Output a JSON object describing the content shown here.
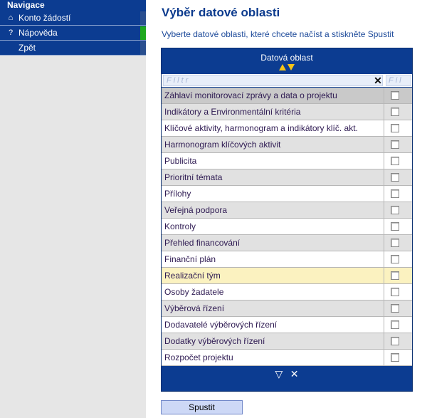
{
  "navigation": {
    "heading": "Navigace",
    "items": [
      {
        "label": "Konto žádostí",
        "icon": "⌂",
        "active": false
      },
      {
        "label": "Nápověda",
        "icon": "?",
        "active": true
      },
      {
        "label": "Zpět",
        "icon": "",
        "active": false
      }
    ]
  },
  "main": {
    "title": "Výběr datové oblasti",
    "subtitle": "Vyberte datové oblasti, které chcete načíst a stiskněte Spustit"
  },
  "grid": {
    "column_header": "Datová oblast",
    "filter_placeholder": "Filtr",
    "filter_placeholder_2": "Fil",
    "clear_glyph": "✕",
    "rows": [
      {
        "label": "Záhlaví monitorovací zprávy a data o projektu",
        "checked": false
      },
      {
        "label": "Indikátory a Environmentální kritéria",
        "checked": false
      },
      {
        "label": "Klíčové aktivity, harmonogram a indikátory klíč. akt.",
        "checked": false
      },
      {
        "label": "Harmonogram klíčových aktivit",
        "checked": false
      },
      {
        "label": "Publicita",
        "checked": false
      },
      {
        "label": "Prioritní témata",
        "checked": false
      },
      {
        "label": "Přílohy",
        "checked": false
      },
      {
        "label": "Veřejná podpora",
        "checked": false
      },
      {
        "label": "Kontroly",
        "checked": false
      },
      {
        "label": "Přehled financování",
        "checked": false
      },
      {
        "label": "Finanční plán",
        "checked": false
      },
      {
        "label": "Realizační tým",
        "checked": false
      },
      {
        "label": "Osoby žadatele",
        "checked": false
      },
      {
        "label": "Výběrová řízení",
        "checked": false
      },
      {
        "label": "Dodavatelé výběrových řízení",
        "checked": false
      },
      {
        "label": "Dodatky výběrových řízení",
        "checked": false
      },
      {
        "label": "Rozpočet projektu",
        "checked": false
      }
    ],
    "footer": {
      "filter_glyph": "▽",
      "clear_glyph": "✕"
    }
  },
  "actions": {
    "run_label": "Spustit"
  },
  "colors": {
    "nav_background": "#0c3c91",
    "active_marker": "#1ea81e",
    "title_color": "#0b3a8d",
    "sort_arrow": "#f3c318",
    "highlight_row": "#fbf2c0"
  }
}
